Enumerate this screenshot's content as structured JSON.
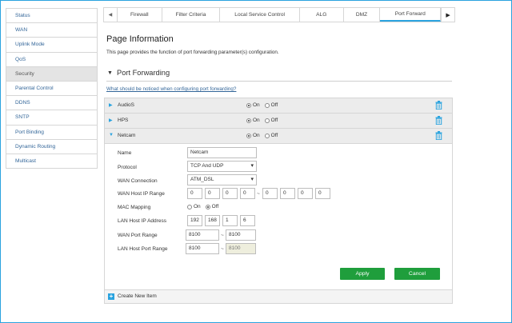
{
  "sidebar": {
    "items": [
      {
        "label": "Status"
      },
      {
        "label": "WAN"
      },
      {
        "label": "Uplink Mode"
      },
      {
        "label": "QoS"
      },
      {
        "label": "Security",
        "active": true
      },
      {
        "label": "Parental Control"
      },
      {
        "label": "DDNS"
      },
      {
        "label": "SNTP"
      },
      {
        "label": "Port Binding"
      },
      {
        "label": "Dynamic Routing"
      },
      {
        "label": "Multicast"
      }
    ]
  },
  "tabs": {
    "items": [
      "Firewall",
      "Filter Criteria",
      "Local Service Control",
      "ALG",
      "DMZ",
      "Port Forward"
    ],
    "active": "Port Forward"
  },
  "page": {
    "title": "Page Information",
    "description": "This page provides the function of port forwarding parameter(s) configuration."
  },
  "section": {
    "title": "Port Forwarding",
    "notice_link": "What should be noticed when configuring port forwarding?"
  },
  "rules": [
    {
      "name": "AudioS",
      "on_label": "On",
      "off_label": "Off",
      "state": "On"
    },
    {
      "name": "HPS",
      "on_label": "On",
      "off_label": "Off",
      "state": "On"
    },
    {
      "name": "Netcam",
      "on_label": "On",
      "off_label": "Off",
      "state": "On"
    }
  ],
  "form": {
    "name_label": "Name",
    "name_value": "Netcam",
    "protocol_label": "Protocol",
    "protocol_value": "TCP And UDP",
    "wan_connection_label": "WAN Connection",
    "wan_connection_value": "ATM_DSL",
    "wan_host_ip_label": "WAN Host IP Range",
    "wan_host_ip_start": [
      "0",
      "0",
      "0",
      "0"
    ],
    "wan_host_ip_end": [
      "0",
      "0",
      "0",
      "0"
    ],
    "mac_mapping_label": "MAC Mapping",
    "mac_on_label": "On",
    "mac_off_label": "Off",
    "mac_state": "Off",
    "lan_host_ip_label": "LAN Host IP Address",
    "lan_host_ip": [
      "192",
      "168",
      "1",
      "6"
    ],
    "wan_port_label": "WAN Port Range",
    "wan_port_start": "8100",
    "wan_port_end": "8100",
    "lan_port_label": "LAN Host Port Range",
    "lan_port_start": "8100",
    "lan_port_end": "8100",
    "range_separator": "~",
    "apply_label": "Apply",
    "cancel_label": "Cancel"
  },
  "create_item_label": "Create New Item",
  "colors": {
    "accent": "#2aa3df",
    "button_green": "#1f9e3c",
    "link": "#336699"
  }
}
